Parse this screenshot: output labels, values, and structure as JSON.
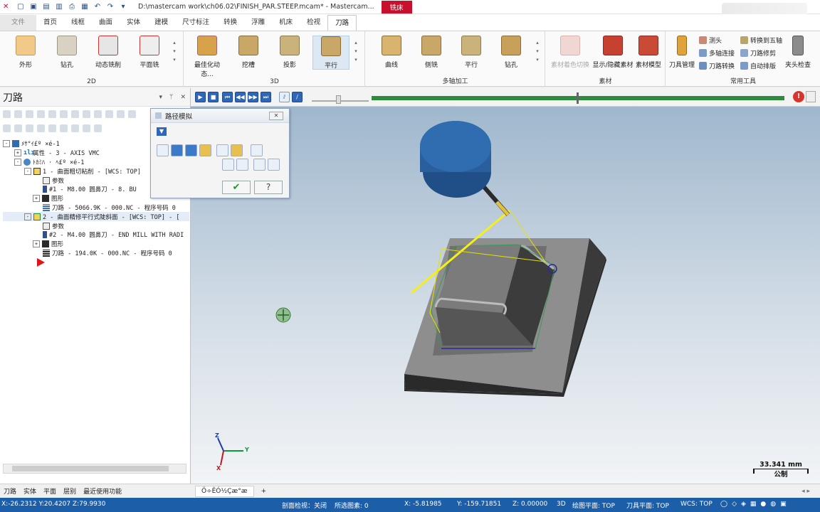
{
  "titlebar": {
    "title": "D:\\mastercam work\\ch06.02\\FINISH_PAR.STEEP.mcam* - Mastercam...",
    "context_tab": "铣床"
  },
  "menu": [
    "文件",
    "首页",
    "线框",
    "曲面",
    "实体",
    "建模",
    "尺寸标注",
    "转换",
    "浮雕",
    "机床",
    "检视",
    "刀路"
  ],
  "ribbon": {
    "group_2d": {
      "label": "2D",
      "buttons": [
        "外形",
        "钻孔",
        "动态铣削",
        "平面铣"
      ]
    },
    "group_3d": {
      "label": "3D",
      "buttons": [
        "最佳化动态...",
        "挖槽",
        "投影",
        "平行"
      ]
    },
    "group_multi": {
      "label": "多轴加工",
      "buttons": [
        "曲线",
        "侧铣",
        "平行",
        "钻孔"
      ]
    },
    "group_stock": {
      "label": "素材",
      "buttons": [
        "素材着色切换",
        "显示/隐藏素材",
        "素材模型"
      ]
    },
    "group_tools": {
      "label": "常用工具",
      "big_buttons": [
        "刀具管理",
        "夹头检查"
      ],
      "small_buttons": [
        "测头",
        "多轴连接",
        "刀路转换",
        "转换到五轴",
        "刀路修剪",
        "自动排版"
      ]
    }
  },
  "left_panel": {
    "title": "刀路",
    "tree": [
      "ﾒｻ°ｲ£º ×é-1",
      "属性 - 3 - AXIS VMC",
      "ﾄｶﾐﾊ · ﾍ£º ×é-1",
      "1 - 曲面粗切粘削 - [WCS: TOP]",
      "参数",
      "#1 - M8.00 圆鼻刀 -   8. BU",
      "图形",
      "刀路 - 5066.9K - 000.NC - 程序号码 0",
      "2 - 曲面精修平行式陡斜面 - [WCS: TOP] - [",
      "参数",
      "#2 - M4.00 圆鼻刀 - END MILL WITH RADI",
      "图形",
      "刀路 - 194.0K - 000.NC - 程序号码 0"
    ],
    "tabs": [
      "刀路",
      "实体",
      "平面",
      "层别",
      "最近使用功能"
    ]
  },
  "dialog": {
    "title": "路径模拟",
    "ok": "✔",
    "help": "?"
  },
  "viewport": {
    "scale_value": "33.341 mm",
    "scale_unit": "公制",
    "axis_x": "X",
    "axis_y": "Y",
    "axis_z": "Z"
  },
  "docbar": {
    "tab": "Ö÷ÊÓ½Çæ°æ"
  },
  "status": {
    "coords": "X:-26.2312  Y:20.4207  Z:79.9930",
    "section": "剖面检视：关闭",
    "selected": "所选图素: 0",
    "x": "X:   -5.81985",
    "y": "Y:   -159.71851",
    "z": "Z:   0.00000",
    "mode": "3D",
    "plane": "绘图平面: TOP",
    "tool_plane": "刀具平面: TOP",
    "wcs": "WCS: TOP"
  },
  "colors": {
    "accent": "#c8102e",
    "status_bar": "#1c5ea8",
    "tool_body": "#2f6db0",
    "part": "#4a4a4a"
  }
}
